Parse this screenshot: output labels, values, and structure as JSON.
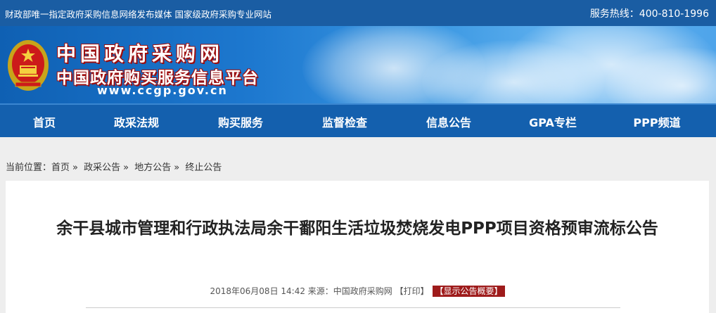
{
  "topbar": {
    "tagline": "财政部唯一指定政府采购信息网络发布媒体 国家级政府采购专业网站",
    "hotline": "服务热线：400-810-1996"
  },
  "banner": {
    "title": "中国政府采购网",
    "subtitle": "中国政府购买服务信息平台",
    "url": "www.ccgp.gov.cn"
  },
  "nav": {
    "items": [
      {
        "label": "首页"
      },
      {
        "label": "政采法规"
      },
      {
        "label": "购买服务"
      },
      {
        "label": "监督检查"
      },
      {
        "label": "信息公告"
      },
      {
        "label": "GPA专栏"
      },
      {
        "label": "PPP频道"
      }
    ]
  },
  "breadcrumb": {
    "prefix": "当前位置：",
    "items": [
      "首页",
      "政采公告",
      "地方公告",
      "终止公告"
    ],
    "separator": "»"
  },
  "article": {
    "title": "余干县城市管理和行政执法局余干鄱阳生活垃圾焚烧发电PPP项目资格预审流标公告",
    "date": "2018年06月08日 14:42",
    "source": "来源：中国政府采购网",
    "print_label": "【打印】",
    "summary_label": "【显示公告概要】"
  },
  "colors": {
    "topbar": "#1a5da3",
    "nav": "#1460ae",
    "summary_badge": "#9e1b1b",
    "logo_shadow": "#9e0e0e"
  }
}
